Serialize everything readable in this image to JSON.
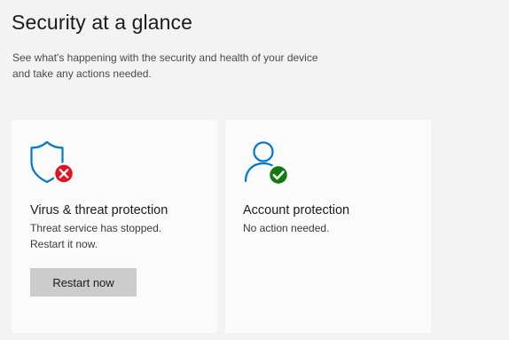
{
  "header": {
    "title": "Security at a glance",
    "description_line1": "See what's happening with the security and health of your device",
    "description_line2": "and take any actions needed."
  },
  "cards": [
    {
      "title": "Virus & threat protection",
      "status_line1": "Threat service has stopped.",
      "status_line2": "Restart it now.",
      "action_label": "Restart now",
      "icon": "shield-icon",
      "badge": "error-x-badge",
      "badge_color": "#e81123"
    },
    {
      "title": "Account protection",
      "status_line1": "No action needed.",
      "icon": "person-icon",
      "badge": "check-badge",
      "badge_color": "#107c10"
    }
  ],
  "colors": {
    "accent": "#0078d4",
    "background": "#f3f3f3",
    "card": "#fbfbfb",
    "button": "#cccccc"
  }
}
